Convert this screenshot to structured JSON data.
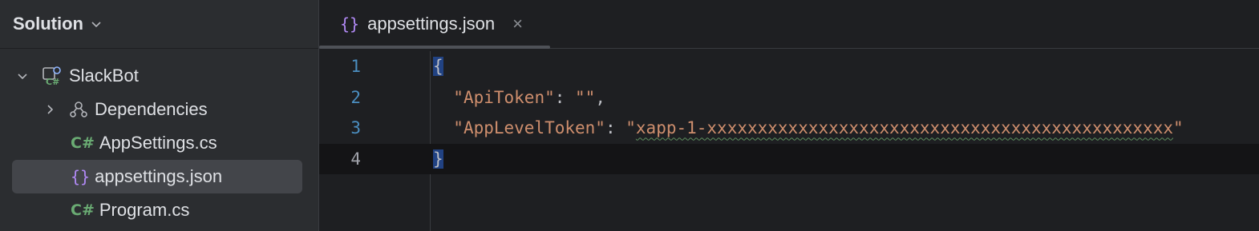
{
  "sidebar": {
    "title": "Solution",
    "tree": [
      {
        "label": "SlackBot",
        "icon": "csharp-project-icon",
        "expanded": true
      },
      {
        "label": "Dependencies",
        "icon": "dependencies-icon",
        "expanded": false
      },
      {
        "label": "AppSettings.cs",
        "icon": "csharp-file-icon",
        "badge": "C#"
      },
      {
        "label": "appsettings.json",
        "icon": "json-file-icon",
        "badge": "{}",
        "selected": true
      },
      {
        "label": "Program.cs",
        "icon": "csharp-file-icon",
        "badge": "C#"
      }
    ]
  },
  "editor": {
    "tab": {
      "label": "appsettings.json",
      "icon": "{}",
      "close": "×"
    },
    "lines": [
      {
        "number": "1",
        "open_brace": "{"
      },
      {
        "number": "2",
        "key": "\"ApiToken\"",
        "sep": ": ",
        "value": "\"\"",
        "tail": ","
      },
      {
        "number": "3",
        "key": "\"AppLevelToken\"",
        "sep": ": ",
        "value_prefix": "\"",
        "value": "xapp-1-xxxxxxxxxxxxxxxxxxxxxxxxxxxxxxxxxxxxxxxxxxxxxx",
        "value_suffix": "\""
      },
      {
        "number": "4",
        "close_brace": "}"
      }
    ]
  },
  "colors": {
    "background": "#1e1f22",
    "sidebar": "#2b2d30",
    "selection": "#43454a",
    "brace_highlight": "#214283",
    "json_key": "#ce8e6d"
  }
}
